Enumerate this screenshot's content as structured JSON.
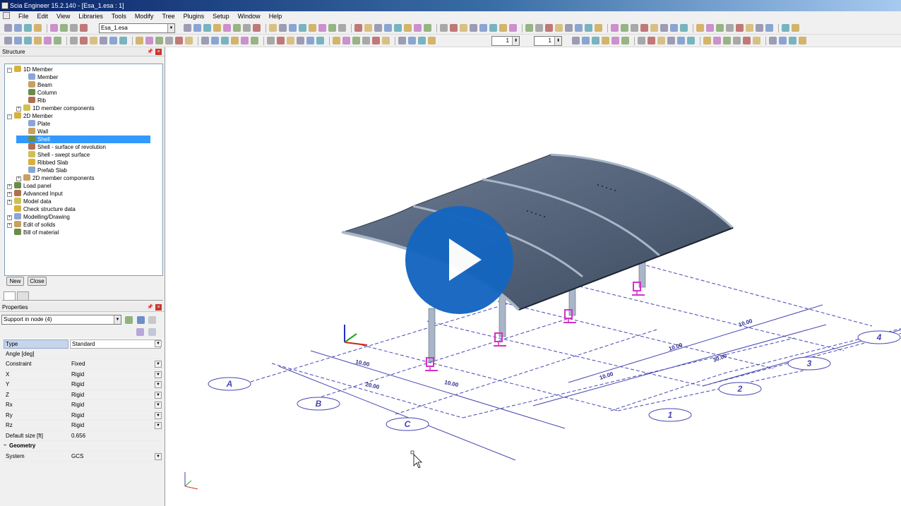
{
  "window": {
    "title": "Scia Engineer 15.2.140 - [Esa_1.esa : 1]"
  },
  "menu": {
    "items": [
      "",
      "File",
      "Edit",
      "View",
      "Libraries",
      "Tools",
      "Modify",
      "Tree",
      "Plugins",
      "Setup",
      "Window",
      "Help"
    ]
  },
  "toolbar": {
    "project_combo_value": "Esa_1.esa",
    "spin1_value": "1",
    "spin2_value": "1"
  },
  "structure_panel": {
    "title": "Structure",
    "items": [
      {
        "label": "1D Member",
        "level": 0,
        "expander": "−",
        "icon": "member-1d-icon"
      },
      {
        "label": "Member",
        "level": 1,
        "icon": "member-icon"
      },
      {
        "label": "Beam",
        "level": 1,
        "icon": "beam-icon"
      },
      {
        "label": "Column",
        "level": 1,
        "icon": "column-icon"
      },
      {
        "label": "Rib",
        "level": 1,
        "icon": "rib-icon"
      },
      {
        "label": "1D member components",
        "level": 1,
        "expander": "+",
        "icon": "components-icon"
      },
      {
        "label": "2D Member",
        "level": 0,
        "expander": "−",
        "icon": "member-2d-icon"
      },
      {
        "label": "Plate",
        "level": 1,
        "icon": "plate-icon"
      },
      {
        "label": "Wall",
        "level": 1,
        "icon": "wall-icon"
      },
      {
        "label": "Shell",
        "level": 1,
        "icon": "shell-icon",
        "selected": true
      },
      {
        "label": "Shell - surface of revolution",
        "level": 1,
        "icon": "shell-revolution-icon"
      },
      {
        "label": "Shell - swept surface",
        "level": 1,
        "icon": "shell-swept-icon"
      },
      {
        "label": "Ribbed Slab",
        "level": 1,
        "icon": "ribbed-slab-icon"
      },
      {
        "label": "Prefab Slab",
        "level": 1,
        "icon": "prefab-slab-icon"
      },
      {
        "label": "2D member components",
        "level": 1,
        "expander": "+",
        "icon": "components-icon"
      },
      {
        "label": "Load panel",
        "level": 0,
        "expander": "+",
        "icon": "load-panel-icon"
      },
      {
        "label": "Advanced Input",
        "level": 0,
        "expander": "+",
        "icon": "advanced-input-icon"
      },
      {
        "label": "Model data",
        "level": 0,
        "expander": "+",
        "icon": "model-data-icon"
      },
      {
        "label": "Check structure data",
        "level": 0,
        "icon": "check-structure-icon"
      },
      {
        "label": "Modelling/Drawing",
        "level": 0,
        "expander": "+",
        "icon": "modelling-icon"
      },
      {
        "label": "Edit of solids",
        "level": 0,
        "expander": "+",
        "icon": "solids-icon"
      },
      {
        "label": "Bill of material",
        "level": 0,
        "icon": "bill-icon"
      }
    ],
    "new_button": "New",
    "close_button": "Close"
  },
  "properties_panel": {
    "title": "Properties",
    "selector_value": "Support in node (4)",
    "rows": [
      {
        "key": "Type",
        "value": "Standard",
        "dropdown": true,
        "kind": "head"
      },
      {
        "key": "Angle [deg]",
        "value": "",
        "dropdown": false,
        "kind": "normal"
      },
      {
        "key": "Constraint",
        "value": "Fixed",
        "dropdown": true,
        "kind": "normal"
      },
      {
        "key": "X",
        "value": "Rigid",
        "dropdown": true,
        "kind": "normal"
      },
      {
        "key": "Y",
        "value": "Rigid",
        "dropdown": true,
        "kind": "normal"
      },
      {
        "key": "Z",
        "value": "Rigid",
        "dropdown": true,
        "kind": "normal"
      },
      {
        "key": "Rx",
        "value": "Rigid",
        "dropdown": true,
        "kind": "normal"
      },
      {
        "key": "Ry",
        "value": "Rigid",
        "dropdown": true,
        "kind": "normal"
      },
      {
        "key": "Rz",
        "value": "Rigid",
        "dropdown": true,
        "kind": "normal"
      },
      {
        "key": "Default size [ft]",
        "value": "0.656",
        "dropdown": false,
        "kind": "normal"
      },
      {
        "key": "Geometry",
        "value": "",
        "dropdown": false,
        "kind": "group"
      },
      {
        "key": "System",
        "value": "GCS",
        "dropdown": true,
        "kind": "normal"
      }
    ]
  },
  "viewport": {
    "grid_labels": [
      "A",
      "B",
      "C",
      "1",
      "2",
      "3",
      "4"
    ],
    "dimensions": [
      "10.00",
      "20.00",
      "10.00",
      "10.00",
      "10.00",
      "10.00",
      "30.00"
    ],
    "colors": {
      "roof": "#4f5e74",
      "roof_edge": "#a9b6c8",
      "grid": "#4646b4",
      "support": "#d430c8"
    }
  },
  "video": {
    "play_icon": "play-icon",
    "color": "#1566c0"
  }
}
